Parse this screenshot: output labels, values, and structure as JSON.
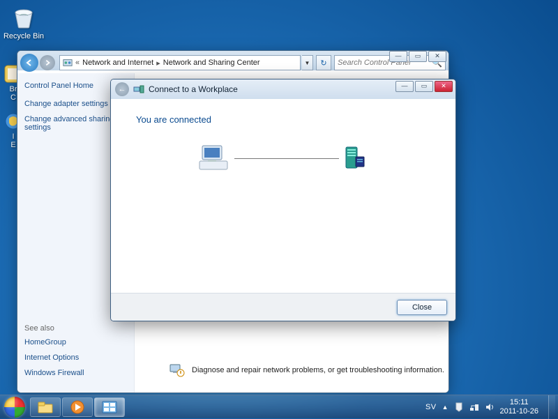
{
  "desktop": {
    "recycle": "Recycle Bin",
    "partial1": "Br",
    "partial1b": "C",
    "partial2": "I",
    "partial2b": "E"
  },
  "cp": {
    "breadcrumb": {
      "sep1": "«",
      "a": "Network and Internet",
      "sep2": "▸",
      "b": "Network and Sharing Center"
    },
    "search_ph": "Search Control Panel",
    "side": {
      "home": "Control Panel Home",
      "l1": "Change adapter settings",
      "l2": "Change advanced sharing settings",
      "seealso": "See also",
      "s1": "HomeGroup",
      "s2": "Internet Options",
      "s3": "Windows Firewall"
    },
    "trouble": "Diagnose and repair network problems, or get troubleshooting information."
  },
  "wizard": {
    "title": "Connect to a Workplace",
    "status": "You are connected",
    "close": "Close"
  },
  "tray": {
    "lang": "SV",
    "time": "15:11",
    "date": "2011-10-26"
  }
}
